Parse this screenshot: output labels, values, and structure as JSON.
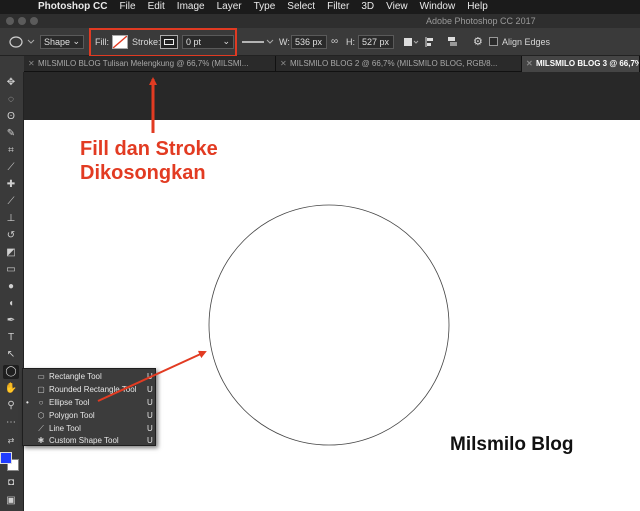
{
  "menubar": {
    "app": "Photoshop CC",
    "items": [
      "File",
      "Edit",
      "Image",
      "Layer",
      "Type",
      "Select",
      "Filter",
      "3D",
      "View",
      "Window",
      "Help"
    ]
  },
  "window": {
    "title": "Adobe Photoshop CC 2017"
  },
  "options": {
    "mode": "Shape",
    "fill_label": "Fill:",
    "stroke_label": "Stroke:",
    "stroke_width": "0 pt",
    "w_label": "W:",
    "w_value": "536 px",
    "h_label": "H:",
    "h_value": "527 px",
    "align_edges": "Align Edges"
  },
  "tabs": [
    {
      "label": "MILSMILO BLOG Tulisan Melengkung @ 66,7% (MILSMI...",
      "active": false
    },
    {
      "label": "MILSMILO BLOG 2 @ 66,7% (MILSMILO BLOG, RGB/8...",
      "active": false
    },
    {
      "label": "MILSMILO BLOG 3 @ 66,7%",
      "active": true
    }
  ],
  "flyout": [
    {
      "label": "Rectangle Tool",
      "key": "U",
      "icon": "rectangle-icon",
      "selected": false
    },
    {
      "label": "Rounded Rectangle Tool",
      "key": "U",
      "icon": "rounded-rectangle-icon",
      "selected": false
    },
    {
      "label": "Ellipse Tool",
      "key": "U",
      "icon": "ellipse-icon",
      "selected": true
    },
    {
      "label": "Polygon Tool",
      "key": "U",
      "icon": "polygon-icon",
      "selected": false
    },
    {
      "label": "Line Tool",
      "key": "U",
      "icon": "line-icon",
      "selected": false
    },
    {
      "label": "Custom Shape Tool",
      "key": "U",
      "icon": "custom-shape-icon",
      "selected": false
    }
  ],
  "annotation": {
    "line1": "Fill dan Stroke",
    "line2": "Dikosongkan"
  },
  "watermark": "Milsmilo Blog",
  "colors": {
    "annotation": "#e23b22",
    "foreground": "#1f3cff",
    "background": "#ffffff"
  }
}
